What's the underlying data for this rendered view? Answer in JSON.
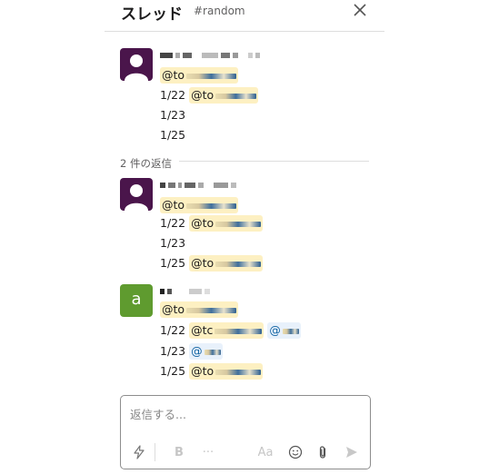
{
  "header": {
    "title": "スレッド",
    "channel": "#random",
    "close_icon": "close-icon"
  },
  "messages": [
    {
      "avatar": "person-avatar",
      "lines": [
        {
          "date": "",
          "mentions": [
            "@to"
          ]
        },
        {
          "date": "1/22",
          "mentions": [
            "@to"
          ]
        },
        {
          "date": "1/23",
          "mentions": []
        },
        {
          "date": "1/25",
          "mentions": []
        }
      ]
    }
  ],
  "replies_divider": "2 件の返信",
  "replies": [
    {
      "avatar": "person-avatar",
      "lines": [
        {
          "date": "",
          "mentions": [
            "@to"
          ]
        },
        {
          "date": "1/22",
          "mentions": [
            "@to"
          ]
        },
        {
          "date": "1/23",
          "mentions": []
        },
        {
          "date": "1/25",
          "mentions": [
            "@to"
          ]
        }
      ]
    },
    {
      "avatar_letter": "a",
      "avatar_color": "#5f9b2f",
      "lines": [
        {
          "date": "",
          "mentions": [
            "@to"
          ]
        },
        {
          "date": "1/22",
          "mentions": [
            "@tc",
            "@"
          ]
        },
        {
          "date": "1/23",
          "mentions": [
            "@"
          ]
        },
        {
          "date": "1/25",
          "mentions": [
            "@to"
          ]
        }
      ]
    }
  ],
  "composer": {
    "placeholder": "返信する...",
    "bold_label": "B",
    "more_label": "···",
    "format_label": "Aa"
  },
  "colors": {
    "mention_bg": "#fdf0c2",
    "mention_text": "#1264a3",
    "avatar_purple": "#4a154b",
    "avatar_green": "#5f9b2f"
  }
}
